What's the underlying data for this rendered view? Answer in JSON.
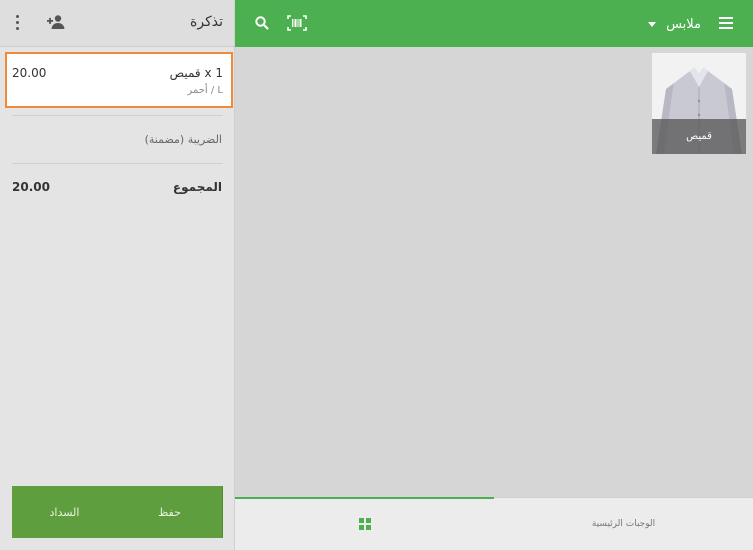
{
  "ticket": {
    "title": "تذكرة",
    "line": {
      "name": "قميص x 1",
      "variant": "أحمر / L",
      "amount": "20.00"
    },
    "tax_label": "الضريبة (مضمنة)",
    "total_label": "المجموع",
    "total_amount": "20.00",
    "buttons": {
      "save": "حفظ",
      "pay": "السداد"
    }
  },
  "topbar": {
    "category": "ملابس",
    "icons": [
      "menu-icon",
      "caret-icon",
      "search-icon",
      "barcode-icon"
    ]
  },
  "products": [
    {
      "name": "قميص",
      "image": "shirt-image"
    }
  ],
  "tabs": {
    "grid_icon": "grid-icon",
    "favorites_label": "الوجبات الرئيسية"
  },
  "colors": {
    "primary_green": "#4caf50",
    "action_green": "#5f9e3e",
    "selection_orange": "#f08a3a"
  }
}
